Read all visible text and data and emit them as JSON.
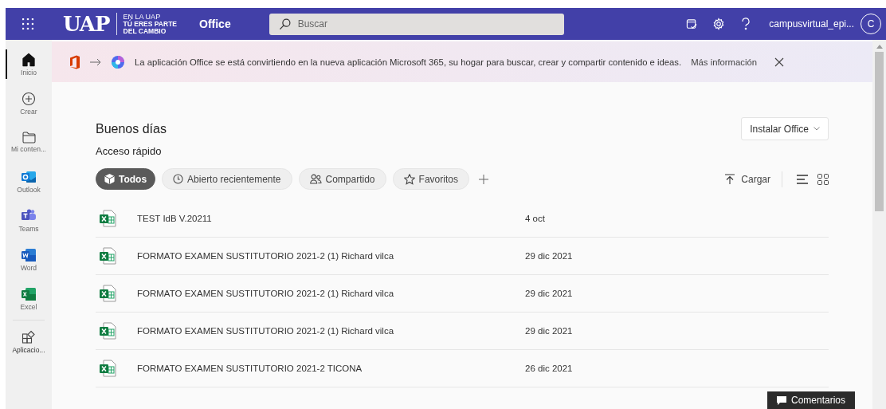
{
  "header": {
    "logo": "UAP",
    "brand_top": "EN LA UAP",
    "brand_line1": "TÚ ERES PARTE",
    "brand_line2": "DEL CAMBIO",
    "app": "Office",
    "search": {
      "placeholder": "Buscar"
    },
    "user": "campusvirtual_epi...",
    "avatar": "C"
  },
  "sidebar": {
    "items": [
      {
        "label": "Inicio",
        "kind": "home",
        "selected": true
      },
      {
        "label": "Crear",
        "kind": "create",
        "selected": false
      },
      {
        "label": "Mi conten...",
        "kind": "folder",
        "selected": false
      },
      {
        "label": "Outlook",
        "kind": "outlook",
        "selected": false
      },
      {
        "label": "Teams",
        "kind": "teams",
        "selected": false
      },
      {
        "label": "Word",
        "kind": "word",
        "selected": false
      },
      {
        "label": "Excel",
        "kind": "excel",
        "selected": false
      },
      {
        "label": "Aplicacio...",
        "kind": "apps",
        "selected": false
      }
    ]
  },
  "banner": {
    "text": "La aplicación Office se está convirtiendo en la nueva aplicación Microsoft 365, su hogar para buscar, crear y compartir contenido e ideas.",
    "link": "Más información"
  },
  "greeting": "Buenos días",
  "install_button": "Instalar Office",
  "section_title": "Acceso rápido",
  "filters": [
    {
      "label": "Todos",
      "kind": "all",
      "selected": true
    },
    {
      "label": "Abierto recientemente",
      "kind": "recent",
      "selected": false
    },
    {
      "label": "Compartido",
      "kind": "shared",
      "selected": false
    },
    {
      "label": "Favoritos",
      "kind": "favorites",
      "selected": false
    }
  ],
  "upload_button": "Cargar",
  "files": [
    {
      "name": "TEST IdB V.20211",
      "date": "4 oct"
    },
    {
      "name": "FORMATO EXAMEN SUSTITUTORIO 2021-2 (1) Richard vilca",
      "date": "29 dic 2021"
    },
    {
      "name": "FORMATO EXAMEN SUSTITUTORIO 2021-2 (1) Richard vilca",
      "date": "29 dic 2021"
    },
    {
      "name": "FORMATO EXAMEN SUSTITUTORIO 2021-2 (1) Richard vilca",
      "date": "29 dic 2021"
    },
    {
      "name": "FORMATO EXAMEN SUSTITUTORIO 2021-2 TICONA",
      "date": "26 dic 2021"
    }
  ],
  "feedback_button": "Comentarios"
}
